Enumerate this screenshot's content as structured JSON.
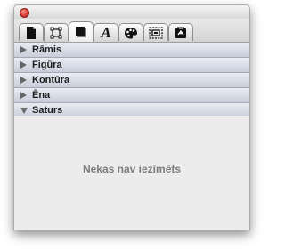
{
  "tabs": [
    {
      "name": "document-icon",
      "active": false
    },
    {
      "name": "arrange-icon",
      "active": false
    },
    {
      "name": "graphic-icon",
      "active": true
    },
    {
      "name": "text-icon",
      "active": false
    },
    {
      "name": "palette-icon",
      "active": false
    },
    {
      "name": "metrics-icon",
      "active": false
    },
    {
      "name": "hyperlink-icon",
      "active": false
    }
  ],
  "tab_text_glyph": "A",
  "sections": [
    {
      "label": "Rāmis",
      "expanded": false
    },
    {
      "label": "Figūra",
      "expanded": false
    },
    {
      "label": "Kontūra",
      "expanded": false
    },
    {
      "label": "Ēna",
      "expanded": false
    },
    {
      "label": "Saturs",
      "expanded": true
    }
  ],
  "content": {
    "empty_message": "Nekas nav iezīmēts"
  },
  "colors": {
    "close_button": "#e0463c",
    "section_header": "#c8cdda",
    "panel_background": "#ececec",
    "empty_text": "#7c7c7c"
  }
}
